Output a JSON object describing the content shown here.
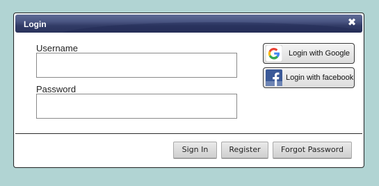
{
  "dialog": {
    "title": "Login",
    "close_icon": "close-icon"
  },
  "form": {
    "username_label": "Username",
    "username_value": "",
    "password_label": "Password",
    "password_value": ""
  },
  "social": {
    "google_label": "Login with Google",
    "google_icon": "google-icon",
    "facebook_label": "Login with facebook",
    "facebook_icon": "facebook-icon"
  },
  "footer": {
    "sign_in_label": "Sign In",
    "register_label": "Register",
    "forgot_password_label": "Forgot Password"
  },
  "colors": {
    "page_background": "#b1d4d3",
    "titlebar": "#3b4573",
    "google_blue": "#4285f4",
    "google_red": "#ea4335",
    "google_yellow": "#fbbc05",
    "google_green": "#34a853",
    "facebook_blue": "#3b5998"
  }
}
